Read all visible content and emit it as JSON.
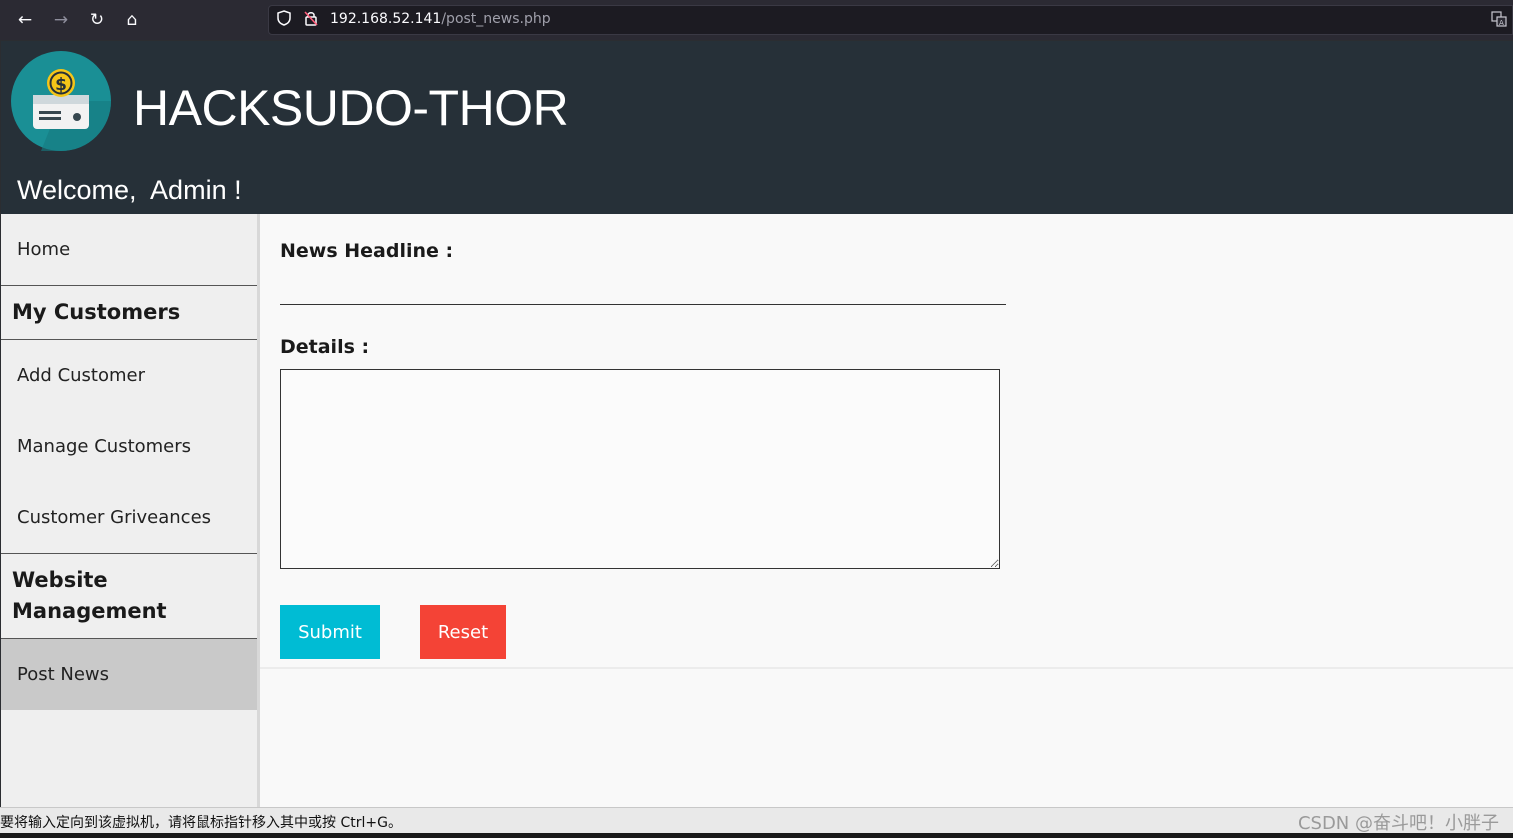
{
  "browser": {
    "url_host": "192.168.52.141",
    "url_path": "/post_news.php",
    "icons": [
      "back-arrow-icon",
      "forward-arrow-icon",
      "reload-icon",
      "home-icon",
      "shield-icon",
      "insecure-lock-icon",
      "translate-icon"
    ]
  },
  "header": {
    "site_title": "HACKSUDO-THOR",
    "welcome": "Welcome,  Admin !",
    "logo_icon": "dollar-card-logo",
    "colors": {
      "header_bg": "#263038",
      "logo_circle": "#1a8f95",
      "logo_coin": "#f5c518"
    }
  },
  "sidebar": {
    "home": "Home",
    "section_customers": "My Customers",
    "add_customer": "Add Customer",
    "manage_customers": "Manage Customers",
    "customer_grievances": "Customer Griveances",
    "section_website_line1": "Website",
    "section_website_line2": "Management",
    "post_news": "Post News"
  },
  "form": {
    "headline_label": "News Headline :",
    "headline_value": "",
    "details_label": "Details :",
    "details_value": "",
    "submit_label": "Submit",
    "reset_label": "Reset",
    "colors": {
      "submit": "#00bcd4",
      "reset": "#f44336"
    }
  },
  "statusbar": {
    "message": "要将输入定向到该虚拟机，请将鼠标指针移入其中或按 Ctrl+G。",
    "watermark": "CSDN @奋斗吧！小胖子"
  }
}
